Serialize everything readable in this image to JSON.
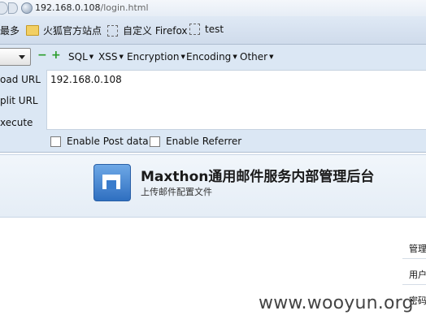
{
  "browser": {
    "url_host": "192.168.0.108",
    "url_path": "/login.html"
  },
  "bookmarks": {
    "most_visited": "最多",
    "items": [
      {
        "label": "火狐官方站点",
        "icon": "folder-icon"
      },
      {
        "label": "自定义 Firefox",
        "icon": "page-icon"
      },
      {
        "label": "test",
        "icon": "page-icon"
      }
    ]
  },
  "hackbar": {
    "add_symbol": "+",
    "remove_symbol": "−",
    "menus": [
      "SQL",
      "XSS",
      "Encryption",
      "Encoding",
      "Other"
    ],
    "actions": [
      "oad URL",
      "plit URL",
      "xecute"
    ],
    "url_value": "192.168.0.108",
    "enable_post": "Enable Post data",
    "enable_referrer": "Enable Referrer"
  },
  "page": {
    "title": "Maxthon通用邮件服务内部管理后台",
    "subtitle": "上传邮件配置文件",
    "right_labels": [
      "管理",
      "用户",
      "密码"
    ]
  },
  "watermark": "www.wooyun.org"
}
